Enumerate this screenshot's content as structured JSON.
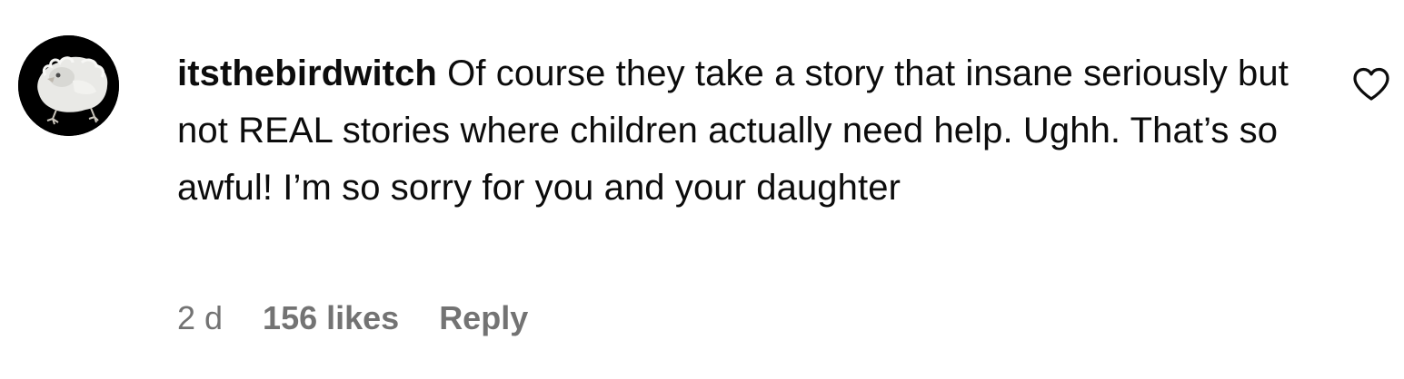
{
  "comment": {
    "username": "itsthebirdwitch",
    "text": "Of course they take a story that insane seriously but not REAL stories where children actually need help. Ughh. That’s so awful! I’m so sorry for you and your daughter",
    "timestamp": "2 d",
    "likes": "156 likes",
    "reply_label": "Reply",
    "avatar_icon": "baby-bird-avatar",
    "like_icon": "heart-outline-icon",
    "colors": {
      "text": "#0c0c0c",
      "meta": "#737373",
      "avatar_bg": "#000000"
    }
  }
}
